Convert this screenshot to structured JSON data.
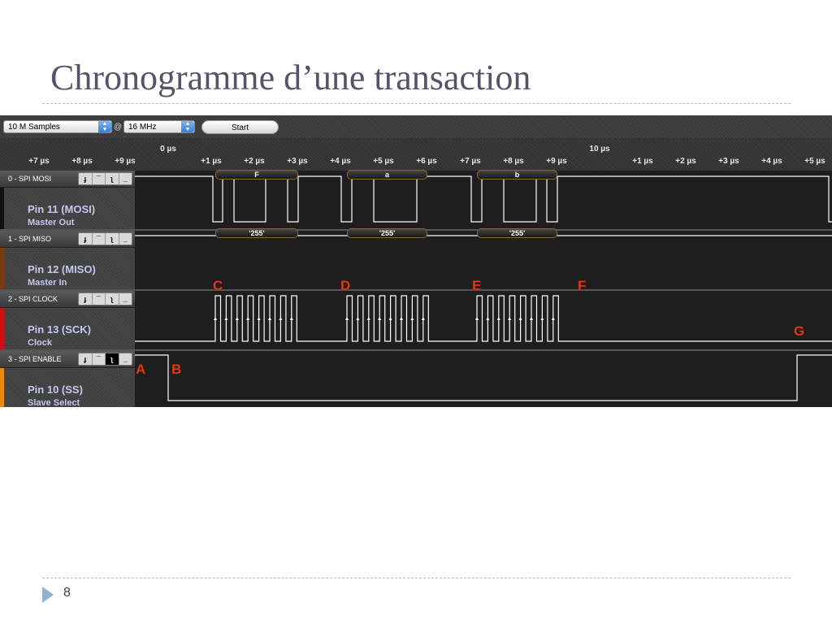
{
  "slide": {
    "title": "Chronogramme d’une transaction",
    "page_number": "8"
  },
  "toolbar": {
    "samples_select": "10 M Samples",
    "at_symbol": "@",
    "rate_select": "16 MHz",
    "start_label": "Start"
  },
  "ruler": {
    "labels_row1": [
      "0 µs",
      "10 µs"
    ],
    "labels_row2": [
      "+7 µs",
      "+8 µs",
      "+9 µs",
      "+1 µs",
      "+2 µs",
      "+3 µs",
      "+4 µs",
      "+5 µs",
      "+6 µs",
      "+7 µs",
      "+8 µs",
      "+9 µs",
      "+1 µs",
      "+2 µs",
      "+3 µs",
      "+4 µs",
      "+5 µs"
    ]
  },
  "channels": [
    {
      "name": "0 - SPI MOSI",
      "pin": "Pin 11 (MOSI)",
      "desc": "Master Out",
      "color": "#111111"
    },
    {
      "name": "1 - SPI MISO",
      "pin": "Pin 12 (MISO)",
      "desc": "Master In",
      "color": "#7a3a10"
    },
    {
      "name": "2 - SPI CLOCK",
      "pin": "Pin 13 (SCK)",
      "desc": "Clock",
      "color": "#d01010"
    },
    {
      "name": "3 - SPI ENABLE",
      "pin": "Pin 10 (SS)",
      "desc": "Slave Select",
      "color": "#e88a10"
    }
  ],
  "trigger_buttons": [
    "rising-edge",
    "high",
    "falling-edge",
    "low"
  ],
  "decoded": {
    "mosi": [
      "F",
      "a",
      "b"
    ],
    "miso": [
      "'255'",
      "'255'",
      "'255'"
    ]
  },
  "markers": [
    "A",
    "B",
    "C",
    "D",
    "E",
    "F",
    "G"
  ],
  "colors": {
    "marker": "#e0431c",
    "trace": "#ffffff",
    "pin_text": "#c4c9f0",
    "title": "#53546a"
  }
}
